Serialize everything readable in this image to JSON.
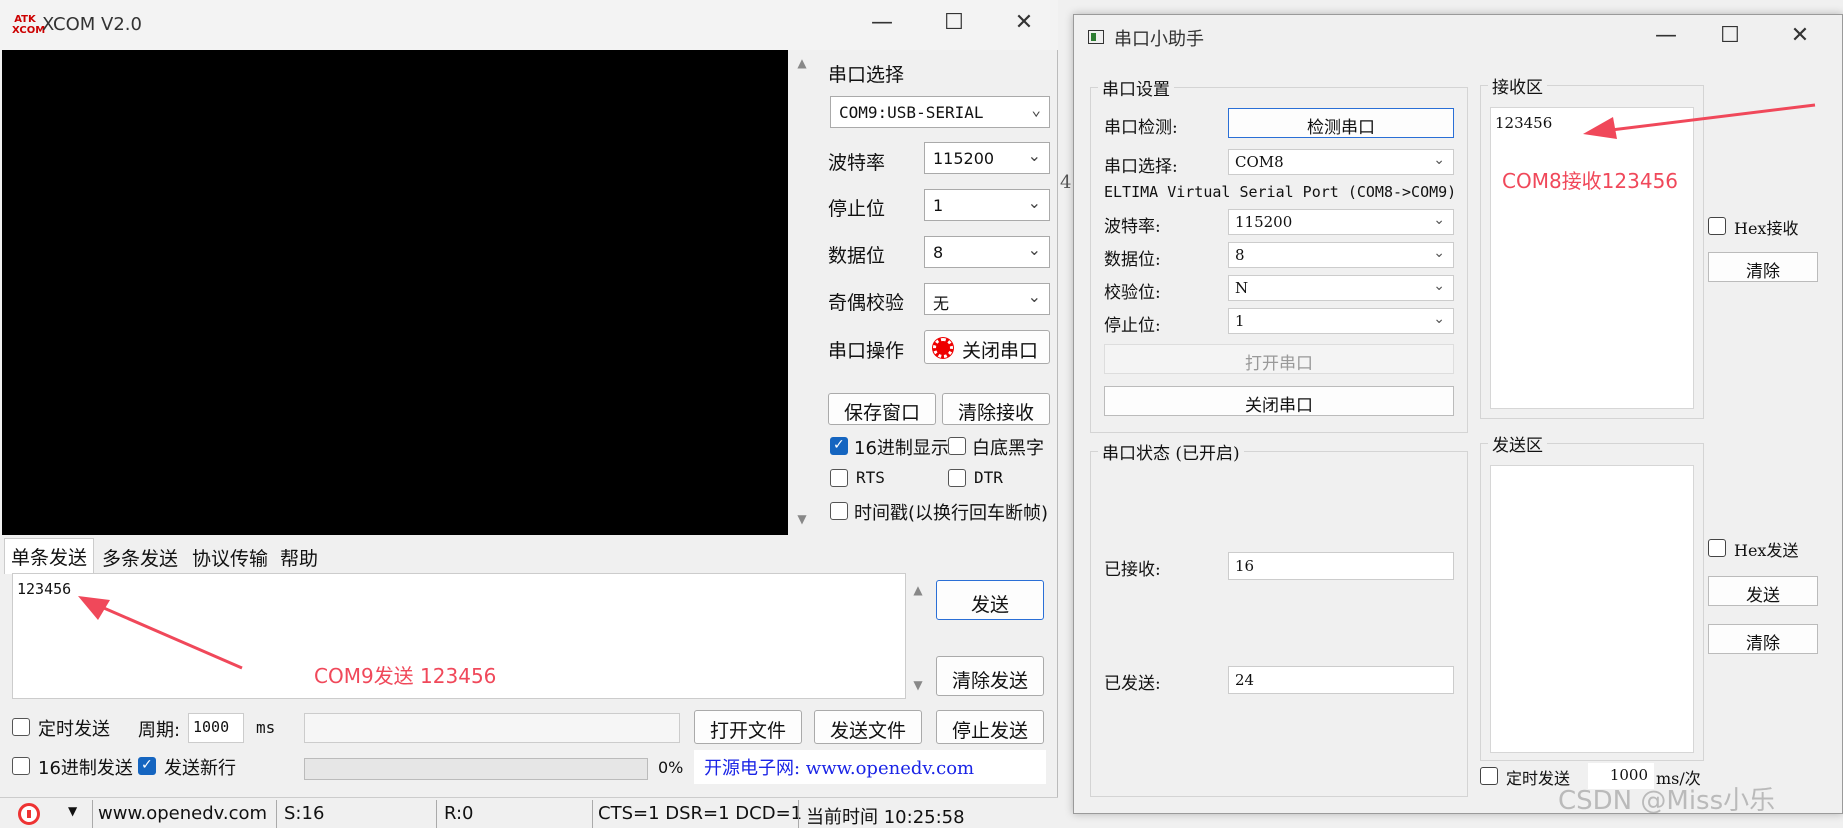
{
  "xcom": {
    "title": "XCOM V2.0",
    "logo_text": "ATK XCOM",
    "win": {
      "min": "—",
      "max": "☐",
      "close": "✕"
    },
    "port_select_label": "串口选择",
    "port_value": "COM9:USB-SERIAL",
    "baud_label": "波特率",
    "baud_value": "115200",
    "stop_label": "停止位",
    "stop_value": "1",
    "data_label": "数据位",
    "data_value": "8",
    "parity_label": "奇偶校验",
    "parity_value": "无",
    "op_label": "串口操作",
    "close_port_btn": "关闭串口",
    "save_window_btn": "保存窗口",
    "clear_recv_btn": "清除接收",
    "hex_display": "16进制显示",
    "white_black": "白底黑字",
    "rts": "RTS",
    "dtr": "DTR",
    "timestamp": "时间戳(以换行回车断帧)",
    "tabs": [
      "单条发送",
      "多条发送",
      "协议传输",
      "帮助"
    ],
    "send_text": "123456",
    "send_btn": "发送",
    "clear_send_btn": "清除发送",
    "annotation": "COM9发送 123456",
    "timed_send": "定时发送",
    "period_label": "周期:",
    "period_value": "1000",
    "ms": "ms",
    "open_file_btn": "打开文件",
    "send_file_btn": "发送文件",
    "stop_send_btn": "停止发送",
    "hex_send": "16进制发送",
    "send_newline": "发送新行",
    "progress": "0%",
    "progress_value": 0,
    "site_banner": "开源电子网: www.openedv.com",
    "status": {
      "url": "www.openedv.com",
      "sent": "S:16",
      "recv": "R:0",
      "lines": "CTS=1 DSR=1 DCD=1",
      "time": "当前时间 10:25:58"
    }
  },
  "helper": {
    "title": "串口小助手",
    "win": {
      "min": "—",
      "max": "☐",
      "close": "✕"
    },
    "settings_group": "串口设置",
    "detect_label": "串口检测:",
    "detect_btn": "检测串口",
    "select_label": "串口选择:",
    "select_value": "COM8",
    "port_desc": "ELTIMA Virtual Serial Port (COM8->COM9)",
    "baud_label": "波特率:",
    "baud_value": "115200",
    "data_label": "数据位:",
    "data_value": "8",
    "parity_label": "校验位:",
    "parity_value": "N",
    "stop_label": "停止位:",
    "stop_value": "1",
    "open_btn": "打开串口",
    "close_btn": "关闭串口",
    "status_group": "串口状态 (已开启)",
    "received_label": "已接收:",
    "received_value": "16",
    "sent_label": "已发送:",
    "sent_value": "24",
    "recv_group": "接收区",
    "recv_text": "123456",
    "annotation": "COM8接收123456",
    "hex_recv": "Hex接收",
    "clear1": "清除",
    "send_group": "发送区",
    "hex_send": "Hex发送",
    "send_btn": "发送",
    "clear2": "清除",
    "timed_send": "定时发送",
    "timed_value": "1000",
    "unit": "ms/次"
  },
  "watermark": "CSDN @Miss小乐",
  "stray_char": "4",
  "accent": "#f0485a"
}
